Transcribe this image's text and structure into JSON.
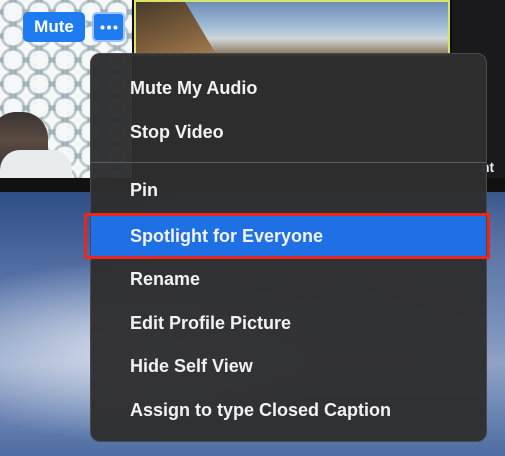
{
  "tile_controls": {
    "mute_label": "Mute",
    "more_icon": "ellipsis-icon"
  },
  "participant_name_peek": "nt",
  "menu": {
    "items": [
      {
        "label": "Mute My Audio"
      },
      {
        "label": "Stop Video"
      },
      {
        "label": "Pin"
      },
      {
        "label": "Spotlight for Everyone",
        "selected": true
      },
      {
        "label": "Rename"
      },
      {
        "label": "Edit Profile Picture"
      },
      {
        "label": "Hide Self View"
      },
      {
        "label": "Assign to type Closed Caption"
      }
    ]
  },
  "colors": {
    "accent": "#1f7cf0",
    "selection": "#1f6fe5",
    "annotation_box": "#e8281e",
    "menu_bg": "#2e2e30",
    "active_speaker_border": "#d7e36a"
  }
}
